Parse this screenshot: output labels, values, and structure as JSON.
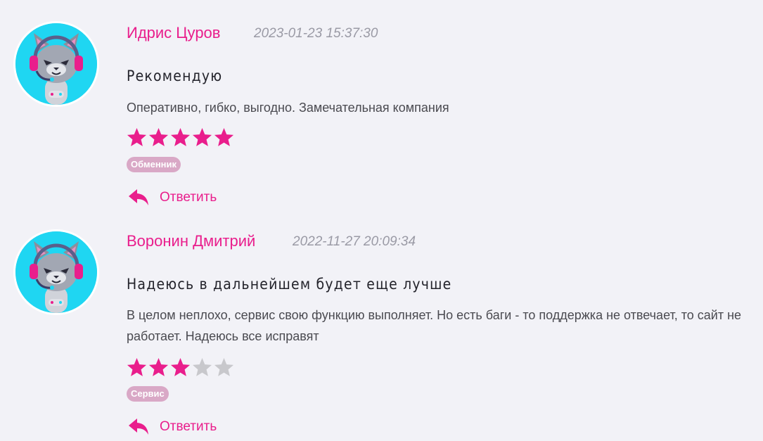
{
  "colors": {
    "accent": "#e91e8c",
    "star_filled": "#e91e8c",
    "star_empty": "#c8c8cc",
    "tag_bg": "#d9a8c6",
    "avatar_bg": "#1fd6f2",
    "page_bg": "#f2f2f7"
  },
  "reviews": [
    {
      "avatar_icon": "gamer-cat-avatar-icon",
      "author": "Идрис Цуров",
      "date": "2023-01-23 15:37:30",
      "title": "Рекомендую",
      "text": "Оперативно, гибко, выгодно. Замечательная компания",
      "rating": 5,
      "rating_max": 5,
      "tag": "Обменник",
      "reply_icon": "reply-arrow-icon",
      "reply_label": "Ответить"
    },
    {
      "avatar_icon": "gamer-cat-avatar-icon",
      "author": "Воронин Дмитрий",
      "date": "2022-11-27 20:09:34",
      "title": "Надеюсь в дальнейшем будет еще лучше",
      "text": "В целом неплохо, сервис свою функцию выполняет. Но есть баги - то поддержка не отвечает, то сайт не работает. Надеюсь все исправят",
      "rating": 3,
      "rating_max": 5,
      "tag": "Сервис",
      "reply_icon": "reply-arrow-icon",
      "reply_label": "Ответить"
    }
  ]
}
